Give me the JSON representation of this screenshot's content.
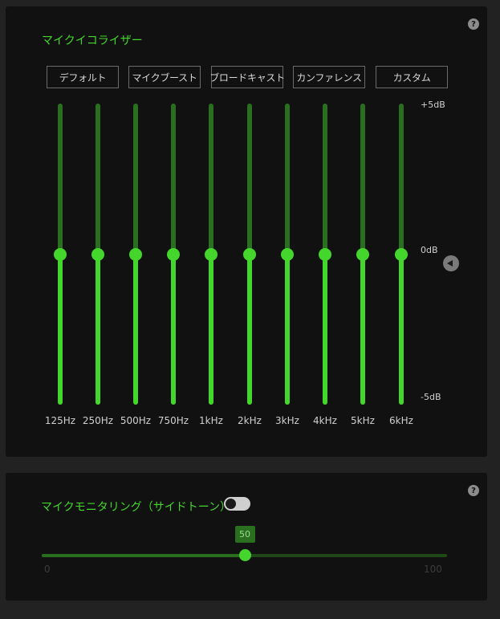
{
  "equalizer": {
    "title": "マイクイコライザー",
    "help_icon": "question-mark-icon",
    "presets": [
      {
        "label": "デフォルト",
        "active": true
      },
      {
        "label": "マイクブースト",
        "active": false
      },
      {
        "label": "ブロードキャスト",
        "active": false
      },
      {
        "label": "カンファレンス",
        "active": false
      },
      {
        "label": "カスタム",
        "active": false
      }
    ],
    "db_labels": {
      "max": "+5dB",
      "mid": "0dB",
      "min": "-5dB"
    },
    "db_range": [
      -5,
      5
    ],
    "bands": [
      {
        "freq": "125Hz",
        "gain_db": 0
      },
      {
        "freq": "250Hz",
        "gain_db": 0
      },
      {
        "freq": "500Hz",
        "gain_db": 0
      },
      {
        "freq": "750Hz",
        "gain_db": 0
      },
      {
        "freq": "1kHz",
        "gain_db": 0
      },
      {
        "freq": "2kHz",
        "gain_db": 0
      },
      {
        "freq": "3kHz",
        "gain_db": 0
      },
      {
        "freq": "4kHz",
        "gain_db": 0
      },
      {
        "freq": "5kHz",
        "gain_db": 0
      },
      {
        "freq": "6kHz",
        "gain_db": 0
      }
    ],
    "collapse_icon": "chevron-left-icon"
  },
  "monitoring": {
    "title": "マイクモニタリング（サイドトーン）",
    "help_icon": "question-mark-icon",
    "toggle_on": false,
    "slider": {
      "value": 50,
      "value_label": "50",
      "min_label": "0",
      "max_label": "100",
      "min": 0,
      "max": 100
    }
  },
  "colors": {
    "accent": "#44d62c",
    "track_dim": "#2a6e1f",
    "panel_bg": "#111111",
    "page_bg": "#222222"
  }
}
